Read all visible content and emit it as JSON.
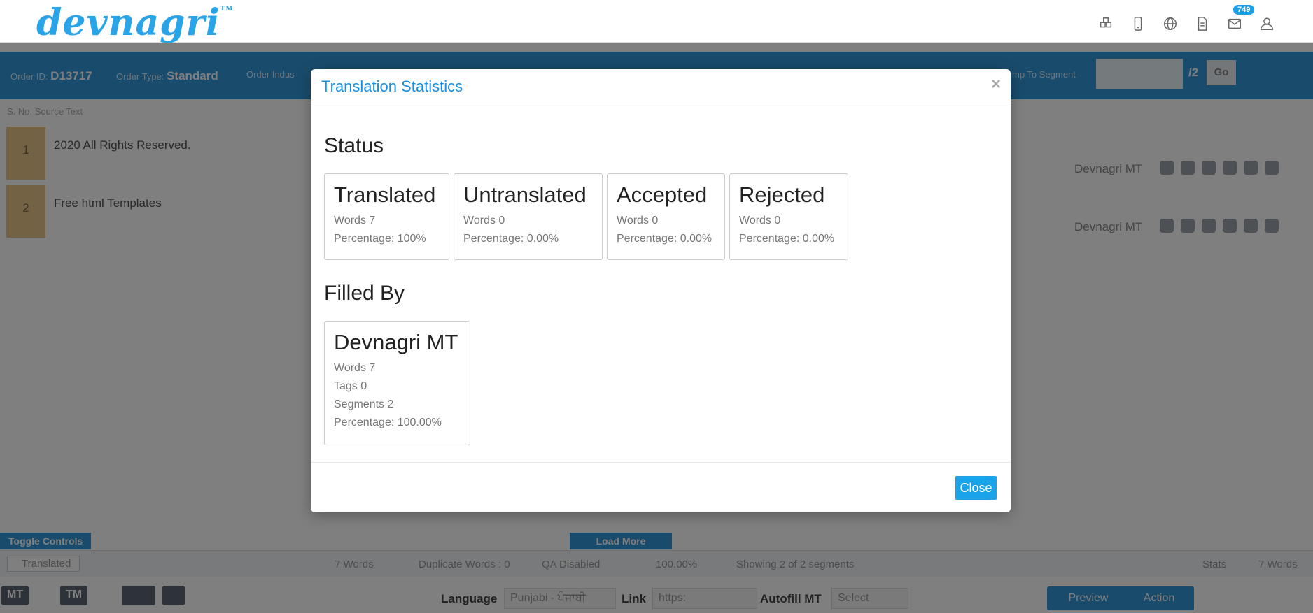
{
  "header": {
    "logo": "devnagri",
    "logo_tm": "TM",
    "icons": [
      "cubes-icon",
      "mobile-icon",
      "globe-icon",
      "document-icon",
      "mail-icon",
      "user-icon"
    ],
    "mail_badge": "749"
  },
  "order_bar": {
    "order_id_label": "Order ID:",
    "order_id": "D13717",
    "order_type_label": "Order Type:",
    "order_type": "Standard",
    "order_industry_label": "Order Indus",
    "jump_label": "mp To Segment",
    "total_segments": "/2",
    "go_label": "Go"
  },
  "segments": {
    "header": "S. No.   Source Text",
    "rows": [
      {
        "num": "1",
        "text": "2020 All Rights Reserved.",
        "filled_by": "Devnagri MT"
      },
      {
        "num": "2",
        "text": "Free html Templates",
        "filled_by": "Devnagri MT"
      }
    ]
  },
  "controls": {
    "toggle_controls": "Toggle Controls",
    "load_more": "Load More"
  },
  "status_bar": {
    "translated": "Translated",
    "words": "7 Words",
    "duplicate_words": "Duplicate Words : 0",
    "qa_disabled": "QA Disabled",
    "percentage": "100.00%",
    "showing": "Showing 2 of 2 segments",
    "stats": "Stats",
    "word_count": "7 Words"
  },
  "bottom_bar": {
    "mt_button": "MT",
    "tm_button": "TM",
    "language_label": "Language",
    "language_value": "Punjabi - ਪੰਜਾਬੀ",
    "link_label": "Link",
    "link_value": "https:",
    "autofill_label": "Autofill MT",
    "autofill_value": "Select",
    "preview": "Preview",
    "action": "Action"
  },
  "modal": {
    "title": "Translation Statistics",
    "close_x": "×",
    "status_heading": "Status",
    "status_cards": [
      {
        "title": "Translated",
        "words": "Words 7",
        "percentage": "Percentage: 100%"
      },
      {
        "title": "Untranslated",
        "words": "Words 0",
        "percentage": "Percentage: 0.00%"
      },
      {
        "title": "Accepted",
        "words": "Words 0",
        "percentage": "Percentage: 0.00%"
      },
      {
        "title": "Rejected",
        "words": "Words 0",
        "percentage": "Percentage: 0.00%"
      }
    ],
    "filled_by_heading": "Filled By",
    "filled_by_card": {
      "title": "Devnagri MT",
      "words": "Words 7",
      "tags": "Tags 0",
      "segments": "Segments 2",
      "percentage": "Percentage: 100.00%"
    },
    "close_button": "Close"
  },
  "colors": {
    "accent": "#1aa3e8",
    "title_blue": "#1a8fe0",
    "order_bar": "#3399d9"
  }
}
